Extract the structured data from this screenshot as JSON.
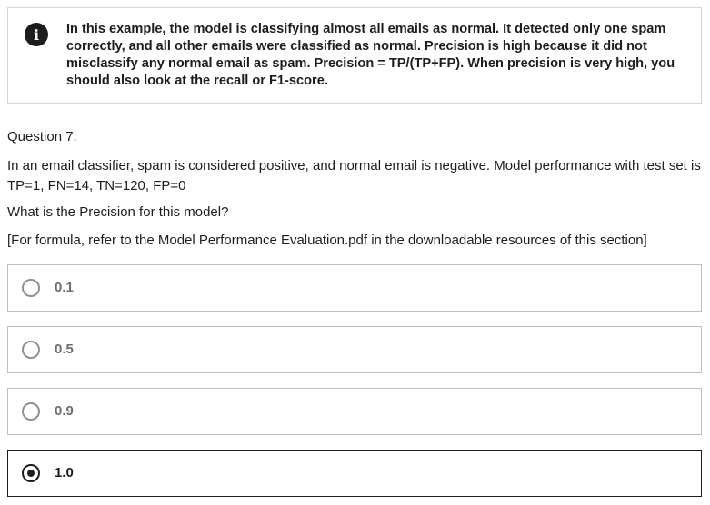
{
  "info": {
    "icon": "info-icon",
    "text": "In this example, the model is classifying almost all emails as normal. It detected only one spam correctly, and all other emails were classified as normal. Precision is high because it did not misclassify any normal email as spam. Precision = TP/(TP+FP). When precision is very high, you should also look at the recall or F1-score."
  },
  "question": {
    "label": "Question 7:",
    "text1": "In an email classifier, spam is considered positive, and normal email is negative.  Model performance with test set is TP=1, FN=14, TN=120, FP=0",
    "text2": "What is the Precision for this model?",
    "text3": "[For formula, refer to the Model Performance Evaluation.pdf in the downloadable resources of this section]"
  },
  "options": [
    {
      "label": "0.1",
      "selected": false
    },
    {
      "label": "0.5",
      "selected": false
    },
    {
      "label": "0.9",
      "selected": false
    },
    {
      "label": "1.0",
      "selected": true
    }
  ],
  "colors": {
    "text": "#1c1d1f",
    "muted_option": "#6a6f73",
    "border": "#d1d7dc"
  }
}
